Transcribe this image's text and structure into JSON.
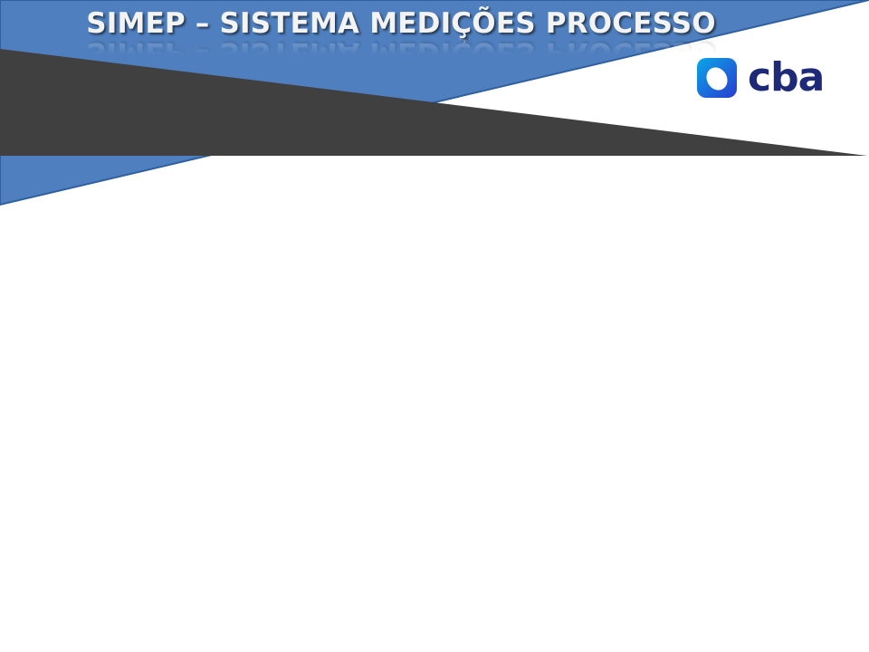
{
  "slide": {
    "title": "SIMEP – SISTEMA MEDIÇÕES PROCESSO"
  },
  "logo": {
    "text": "cba",
    "icon": "cba-logo-icon"
  },
  "colors": {
    "band_blue": "#4f7fbe",
    "band_blue_edge": "#2f5f9e",
    "band_dark": "#404040",
    "logo_text": "#1e2a78",
    "logo_gradient_start": "#0aa7e8",
    "logo_gradient_end": "#2a3bd0",
    "title_text": "#f3f3f3"
  }
}
